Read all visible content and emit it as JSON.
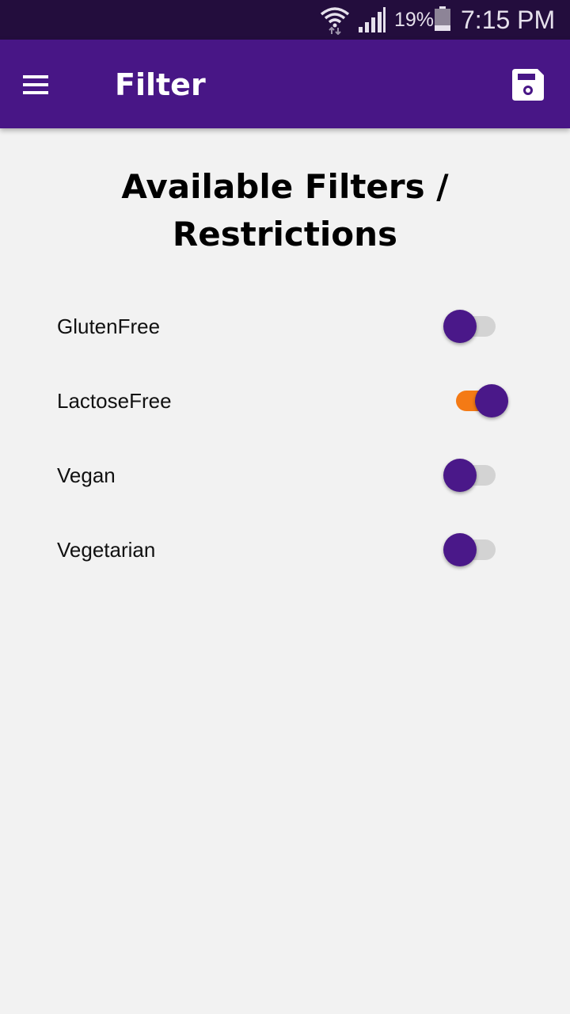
{
  "status_bar": {
    "battery_percent": "19%",
    "time": "7:15 PM",
    "icons": [
      "wifi-icon",
      "signal-icon",
      "battery-icon"
    ]
  },
  "app_bar": {
    "title": "Filter",
    "menu_icon": "menu-icon",
    "save_icon": "save-icon",
    "color": "#481686"
  },
  "main": {
    "heading": "Available Filters / Restrictions",
    "filters": [
      {
        "label": "GlutenFree",
        "enabled": false
      },
      {
        "label": "LactoseFree",
        "enabled": true
      },
      {
        "label": "Vegan",
        "enabled": false
      },
      {
        "label": "Vegetarian",
        "enabled": false
      }
    ]
  },
  "colors": {
    "status_bar": "#230d3d",
    "switch_thumb": "#4a1889",
    "switch_track_on": "#f47a15",
    "switch_track_off": "#d3d3d3",
    "background": "#f2f2f2"
  }
}
